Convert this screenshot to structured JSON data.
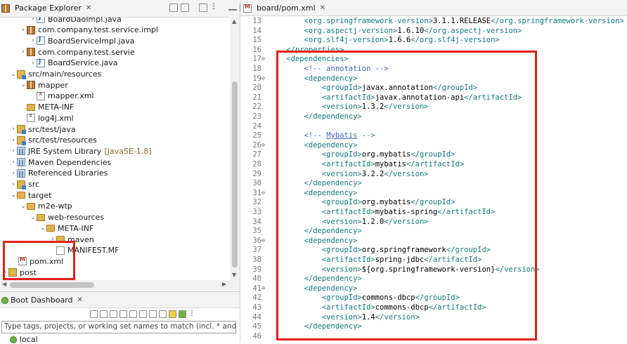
{
  "package_explorer": {
    "title": "Package Explorer",
    "tree": [
      {
        "label": "BoardDaoImpl.java",
        "suffix": "",
        "icon": "java-file-icon"
      },
      {
        "label": "com.company.test.service.impl",
        "suffix": "",
        "icon": "package-icon"
      },
      {
        "label": "BoardServiceImpl.java",
        "suffix": "",
        "icon": "java-file-icon"
      },
      {
        "label": "com.company.test.servie",
        "suffix": "",
        "icon": "package-icon"
      },
      {
        "label": "BoardService.java",
        "suffix": "",
        "icon": "java-file-icon"
      },
      {
        "label": "src/main/resources",
        "suffix": "",
        "icon": "source-folder-icon"
      },
      {
        "label": "mapper",
        "suffix": "",
        "icon": "package-icon"
      },
      {
        "label": "mapper.xml",
        "suffix": "",
        "icon": "xml-file-icon"
      },
      {
        "label": "META-INF",
        "suffix": "",
        "icon": "folder-icon"
      },
      {
        "label": "log4j.xml",
        "suffix": "",
        "icon": "xml-file-icon"
      },
      {
        "label": "src/test/java",
        "suffix": "",
        "icon": "source-folder-icon"
      },
      {
        "label": "src/test/resources",
        "suffix": "",
        "icon": "source-folder-icon"
      },
      {
        "label": "JRE System Library",
        "suffix": "[JavaSE-1.8]",
        "icon": "library-icon"
      },
      {
        "label": "Maven Dependencies",
        "suffix": "",
        "icon": "library-icon"
      },
      {
        "label": "Referenced Libraries",
        "suffix": "",
        "icon": "library-icon"
      },
      {
        "label": "src",
        "suffix": "",
        "icon": "source-folder-icon"
      },
      {
        "label": "target",
        "suffix": "",
        "icon": "folder-icon"
      },
      {
        "label": "m2e-wtp",
        "suffix": "",
        "icon": "folder-icon"
      },
      {
        "label": "web-resources",
        "suffix": "",
        "icon": "folder-icon"
      },
      {
        "label": "META-INF",
        "suffix": "",
        "icon": "folder-icon"
      },
      {
        "label": "maven",
        "suffix": "",
        "icon": "folder-icon"
      },
      {
        "label": "MANIFEST.MF",
        "suffix": "",
        "icon": "manifest-file-icon"
      },
      {
        "label": "pom.xml",
        "suffix": "",
        "icon": "pom-file-icon"
      },
      {
        "label": "post",
        "suffix": "",
        "icon": "project-icon"
      }
    ]
  },
  "boot_dashboard": {
    "title": "Boot Dashboard",
    "filter_text": "Type tags, projects, or working set names to match (incl. * and ? wildca",
    "item": "local"
  },
  "editor": {
    "tab_title": "board/pom.xml",
    "lines": [
      {
        "n": "13",
        "fold": "",
        "text": "        <org.springframework-version>3.1.1.RELEASE</org.springframework-version>"
      },
      {
        "n": "14",
        "fold": "",
        "text": "        <org.aspectj-version>1.6.10</org.aspectj-version>"
      },
      {
        "n": "15",
        "fold": "",
        "text": "        <org.slf4j-version>1.6.6</org.slf4j-version>"
      },
      {
        "n": "16",
        "fold": "",
        "text": "    </properties>"
      },
      {
        "n": "17",
        "fold": "⊖",
        "text": "    <dependencies>"
      },
      {
        "n": "18",
        "fold": "",
        "text": "        <!-- annotation -->"
      },
      {
        "n": "19",
        "fold": "⊖",
        "text": "        <dependency>"
      },
      {
        "n": "20",
        "fold": "",
        "text": "            <groupId>javax.annotation</groupId>"
      },
      {
        "n": "21",
        "fold": "",
        "text": "            <artifactId>javax.annotation-api</artifactId>"
      },
      {
        "n": "22",
        "fold": "",
        "text": "            <version>1.3.2</version>"
      },
      {
        "n": "23",
        "fold": "",
        "text": "        </dependency>"
      },
      {
        "n": "24",
        "fold": "",
        "text": ""
      },
      {
        "n": "25",
        "fold": "",
        "text": "        <!-- Mybatis -->"
      },
      {
        "n": "26",
        "fold": "⊖",
        "text": "        <dependency>"
      },
      {
        "n": "27",
        "fold": "",
        "text": "            <groupId>org.mybatis</groupId>"
      },
      {
        "n": "28",
        "fold": "",
        "text": "            <artifactId>mybatis</artifactId>"
      },
      {
        "n": "29",
        "fold": "",
        "text": "            <version>3.2.2</version>"
      },
      {
        "n": "30",
        "fold": "",
        "text": "        </dependency>"
      },
      {
        "n": "31",
        "fold": "⊖",
        "text": "        <dependency>"
      },
      {
        "n": "32",
        "fold": "",
        "text": "            <groupId>org.mybatis</groupId>"
      },
      {
        "n": "33",
        "fold": "",
        "text": "            <artifactId>mybatis-spring</artifactId>"
      },
      {
        "n": "34",
        "fold": "",
        "text": "            <version>1.2.0</version>"
      },
      {
        "n": "35",
        "fold": "",
        "text": "        </dependency>"
      },
      {
        "n": "36",
        "fold": "⊖",
        "text": "        <dependency>"
      },
      {
        "n": "37",
        "fold": "",
        "text": "            <groupId>org.springframework</groupId>"
      },
      {
        "n": "38",
        "fold": "",
        "text": "            <artifactId>spring-jdbc</artifactId>"
      },
      {
        "n": "39",
        "fold": "",
        "text": "            <version>${org.springframework-version}</version>"
      },
      {
        "n": "40",
        "fold": "",
        "text": "        </dependency>"
      },
      {
        "n": "41",
        "fold": "⊖",
        "text": "        <dependency>"
      },
      {
        "n": "42",
        "fold": "",
        "text": "            <groupId>commons-dbcp</groupId>"
      },
      {
        "n": "43",
        "fold": "",
        "text": "            <artifactId>commons-dbcp</artifactId>"
      },
      {
        "n": "44",
        "fold": "",
        "text": "            <version>1.4</version>"
      },
      {
        "n": "45",
        "fold": "",
        "text": "        </dependency>"
      },
      {
        "n": "46",
        "fold": "",
        "text": ""
      }
    ]
  },
  "colors": {
    "highlight": "#e3201b",
    "xml_tag": "#117a7a",
    "xml_comment": "#3f5fbf"
  }
}
